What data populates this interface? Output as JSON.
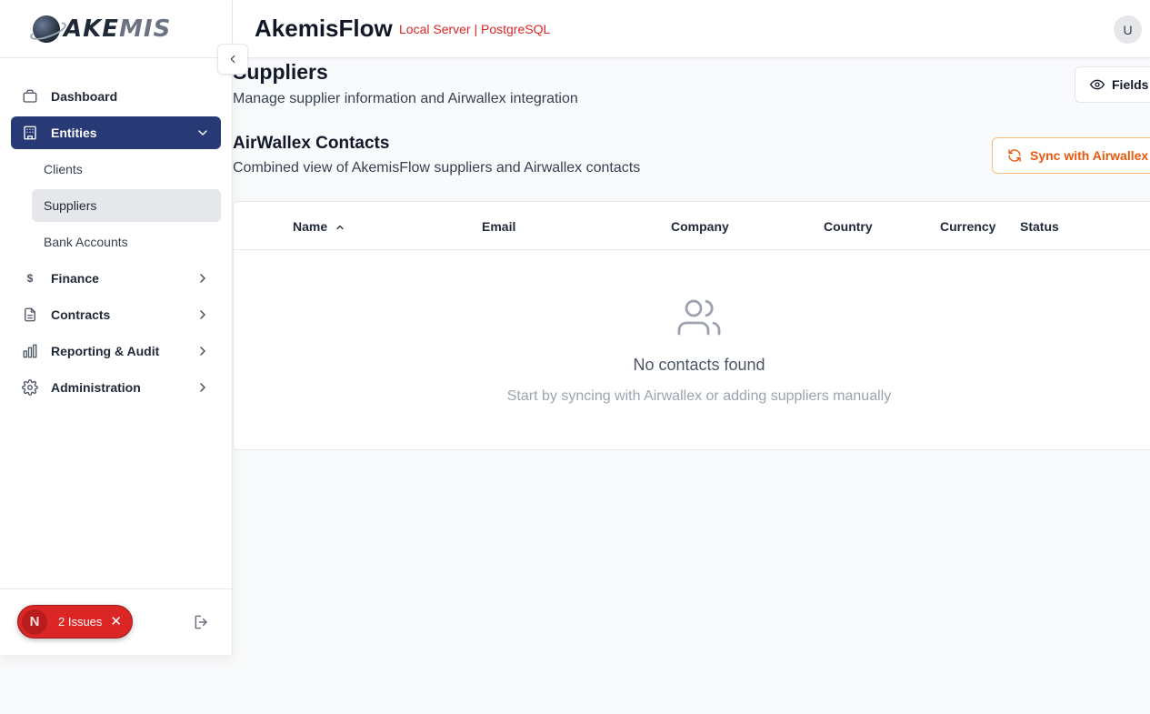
{
  "header": {
    "app_title": "AkemisFlow",
    "server_label": "Local Server | PostgreSQL",
    "avatar_initial": "U"
  },
  "logo": {
    "text_a": "AKE",
    "text_b": "MIS"
  },
  "sidebar": {
    "items": [
      {
        "label": "Dashboard",
        "icon": "briefcase-icon"
      },
      {
        "label": "Entities",
        "icon": "building-icon",
        "active": true,
        "expanded": true,
        "children": [
          {
            "label": "Clients"
          },
          {
            "label": "Suppliers",
            "selected": true
          },
          {
            "label": "Bank Accounts"
          }
        ]
      },
      {
        "label": "Finance",
        "icon": "dollar-icon"
      },
      {
        "label": "Contracts",
        "icon": "document-icon"
      },
      {
        "label": "Reporting & Audit",
        "icon": "bar-chart-icon"
      },
      {
        "label": "Administration",
        "icon": "gear-icon"
      }
    ],
    "footer": {
      "issues_badge_letter": "N",
      "issues_label": "2 Issues"
    }
  },
  "page": {
    "title": "Suppliers",
    "subtitle": "Manage supplier information and Airwallex integration",
    "fields_button": "Fields"
  },
  "section": {
    "title": "AirWallex Contacts",
    "subtitle": "Combined view of AkemisFlow suppliers and Airwallex contacts",
    "sync_button": "Sync with Airwallex"
  },
  "table": {
    "columns": [
      "Name",
      "Email",
      "Company",
      "Country",
      "Currency",
      "Status"
    ],
    "empty_title": "No contacts found",
    "empty_subtitle": "Start by syncing with Airwallex or adding suppliers manually"
  },
  "colors": {
    "active_nav": "#283a75",
    "server_label": "#dc2626",
    "sync_accent": "#ea580c",
    "issues_pill": "#dc2626"
  }
}
